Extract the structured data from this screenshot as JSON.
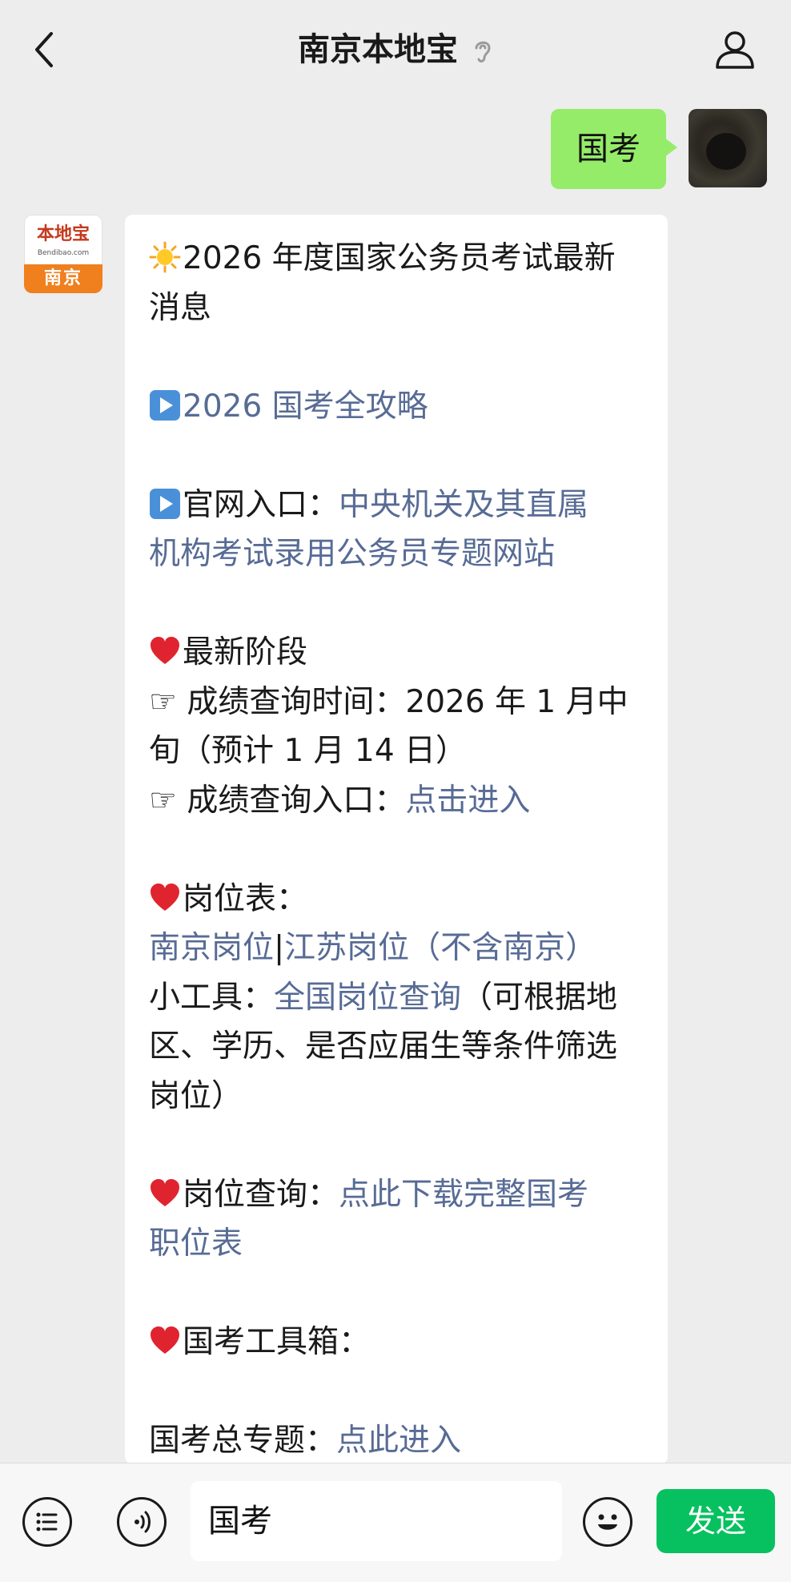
{
  "header": {
    "title": "南京本地宝"
  },
  "outgoing": {
    "text": "国考"
  },
  "avatar_bot": {
    "top": "本地宝",
    "mid": "Bendibao.com",
    "bottom": "南京"
  },
  "message": {
    "line1": "2026 年度国家公务员考试最新",
    "line2": "消息",
    "guide_link": "2026 国考全攻略",
    "official_label": "官网入口：",
    "official_link_1": "中央机关及其直属",
    "official_link_2": "机构考试录用公务员专题网站",
    "stage_title": "最新阶段",
    "score_time_label": "成绩查询时间：2026 年 1 月中",
    "score_time_cont": "旬（预计 1 月 14 日）",
    "score_entry_label": "成绩查询入口：",
    "score_entry_link": "点击进入",
    "jobs_title": "岗位表：",
    "nanjing_link": "南京岗位",
    "separator": "|",
    "jiangsu_link": "江苏岗位（不含南京）",
    "tool_label": "小工具：",
    "tool_link": "全国岗位查询",
    "tool_desc_1": "（可根据地",
    "tool_desc_2": "区、学历、是否应届生等条件筛选",
    "tool_desc_3": "岗位）",
    "query_label": "岗位查询：",
    "query_link_1": "点此下载完整国考",
    "query_link_2": "职位表",
    "toolbox_title": "国考工具箱：",
    "topic_label": "国考总专题：",
    "topic_link": "点此进入"
  },
  "input": {
    "text": "国考"
  },
  "send": {
    "label": "发送"
  },
  "colors": {
    "link": "#576b95",
    "send": "#07c160",
    "bubble_me": "#95ec69"
  }
}
